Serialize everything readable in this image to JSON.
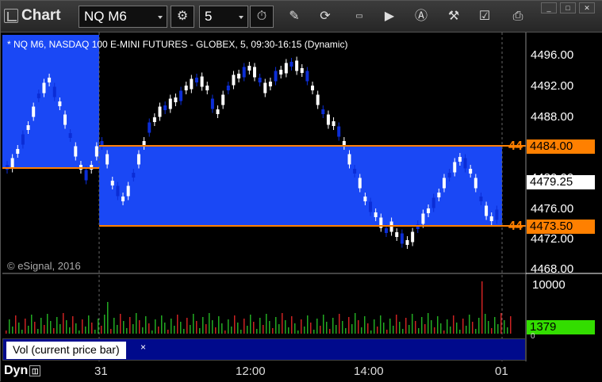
{
  "window": {
    "title": "Chart"
  },
  "toolbar": {
    "symbol": "NQ M6",
    "interval": "5",
    "buttons": [
      "gear-icon",
      "clock-icon",
      "pencil-icon",
      "refresh-icon",
      "get-icon",
      "play-icon",
      "alert-icon",
      "tools-icon",
      "link-icon",
      "print-icon"
    ]
  },
  "chart": {
    "legend": "* NQ M6, NASDAQ 100 E-MINI FUTURES - GLOBEX, 5, 09:30-16:15 (Dynamic)",
    "copyright": "© eSignal, 2016",
    "price_labels": [
      "4496.00",
      "4492.00",
      "4488.00",
      "4480.00",
      "4476.00",
      "4472.00",
      "4468.00"
    ],
    "price_label_last": "4479.25",
    "level_upper": "4484.00",
    "level_lower": "4473.50",
    "level_upper_left": "44",
    "level_lower_left": "44",
    "time_labels": [
      "31",
      "12:00",
      "14:00",
      "01"
    ],
    "volume_scale": "10000",
    "volume_last": "1379",
    "volume_unit": "0",
    "indicator_label": "Vol (current price bar)",
    "bottom_label": "Dyn"
  },
  "colors": {
    "box_blue": "#1a48f5",
    "orange": "#ff8000",
    "green": "#33dd00",
    "up_candle": "#ffffff",
    "down_candle": "#0b2dd6"
  }
}
